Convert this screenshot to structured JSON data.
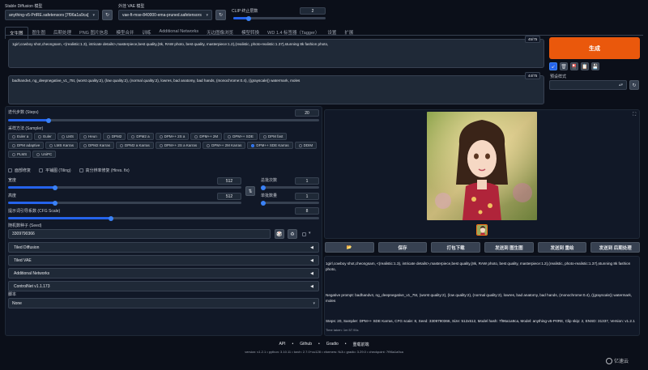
{
  "top": {
    "sd_model_label": "Stable Diffusion 模型",
    "sd_model_value": "anything-v5-PrtRE.safetensors [7f96a1a9ca]",
    "vae_label": "外挂 VAE 模型",
    "vae_value": "vae-ft-mse-840000-ema-pruned.safetensors",
    "clip_label": "CLIP 终止层数",
    "clip_value": "2",
    "clip_fraction": 0.17
  },
  "tabs": [
    "文生图",
    "图生图",
    "后期处理",
    "PNG 图片信息",
    "模型合并",
    "训练",
    "Additional Networks",
    "无边图像浏览",
    "模型转换",
    "WD 1.4 标签器（Tagger）",
    "设置",
    "扩展"
  ],
  "prompt": {
    "positive": "1girl,cowboy shot,cheongsam, <(realistic:1.3), intricate details>,masterpiece,best quality,(8k, RAW photo, best quality, masterpiece:1.2),(realistic, photo-realistic:1.37),stunning 8k fashion photo,",
    "positive_count": "45/75",
    "negative": "badhandv4, ng_deepnegative_v1_75t, (worst quality:2), (low quality:2), (normal quality:2), lowres, bad anatomy, bad hands, (monochrome:0.4), ((grayscale)) watermark, moles",
    "negative_count": "44/75"
  },
  "generate": {
    "label": "生成",
    "style_label": "预设样式"
  },
  "params": {
    "steps_label": "迭代步数 (Steps)",
    "steps_value": "20",
    "steps_fraction": 0.13,
    "sampler_label": "采样方法 (Sampler)",
    "samplers": [
      "Euler a",
      "Euler",
      "LMS",
      "Heun",
      "DPM2",
      "DPM2 a",
      "DPM++ 2S a",
      "DPM++ 2M",
      "DPM++ SDE",
      "DPM fast",
      "DPM adaptive",
      "LMS Karras",
      "DPM2 Karras",
      "DPM2 a Karras",
      "DPM++ 2S a Karras",
      "DPM++ 2M Karras",
      "DPM++ SDE Karras",
      "DDIM",
      "PLMS",
      "UniPC"
    ],
    "selected_sampler": "DPM++ SDE Karras",
    "opt_restore_faces": "面部修复",
    "opt_tiling": "平铺图 (Tiling)",
    "opt_hires": "高分辨率修复 (Hires. fix)",
    "width_label": "宽度",
    "width_value": "512",
    "width_fraction": 0.2,
    "height_label": "高度",
    "height_value": "512",
    "height_fraction": 0.2,
    "batch_count_label": "总批次数",
    "batch_count_value": "1",
    "batch_size_label": "单批数量",
    "batch_size_value": "1",
    "cfg_label": "提示词引导系数 (CFG Scale)",
    "cfg_value": "8",
    "cfg_fraction": 0.33,
    "seed_label": "随机数种子 (Seed)",
    "seed_value": "3309790366"
  },
  "accordions": [
    "Tiled Diffusion",
    "Tiled VAE",
    "Additional Networks",
    "ControlNet v1.1.173"
  ],
  "script": {
    "label": "脚本",
    "value": "None"
  },
  "output": {
    "buttons": [
      "📂",
      "保存",
      "打包下载",
      "发送到 图生图",
      "发送到 重绘",
      "发送到 后期处理"
    ],
    "info_prompt": "1girl,cowboy shot,cheongsam, <(realistic:1.3), intricate details>,masterpiece,best quality,(8k, RAW photo, best quality, masterpiece:1.2),(realistic, photo-realistic:1.37),stunning 8k fashion photo,",
    "info_negative": "Negative prompt: badhandv4, ng_deepnegative_v1_75t, (worst quality:2), (low quality:2), (normal quality:2), lowres, bad anatomy, bad hands, (monochrome:0.4), ((grayscale)) watermark, moles",
    "info_params": "Steps: 20, Sampler: DPM++ SDE Karras, CFG scale: 8, Seed: 3309790366, Size: 512x512, Model hash: 7f96a1a9ca, Model: anything-v5-PrtRE, Clip skip: 2, ENSD: 31337, Version: v1.2.1",
    "time_taken": "Time taken: 1m 57.91s"
  },
  "footer": {
    "links": [
      "API",
      "Github",
      "Gradio",
      "重载前端"
    ],
    "info": "version: v1.2.1  •  python: 3.10.11  •  torch: 2.7.0+cu128  •  xformers: N/A  •  gradio: 3.29.0  •  checkpoint: 7f96a1a9ca"
  },
  "watermark": "亿速云"
}
